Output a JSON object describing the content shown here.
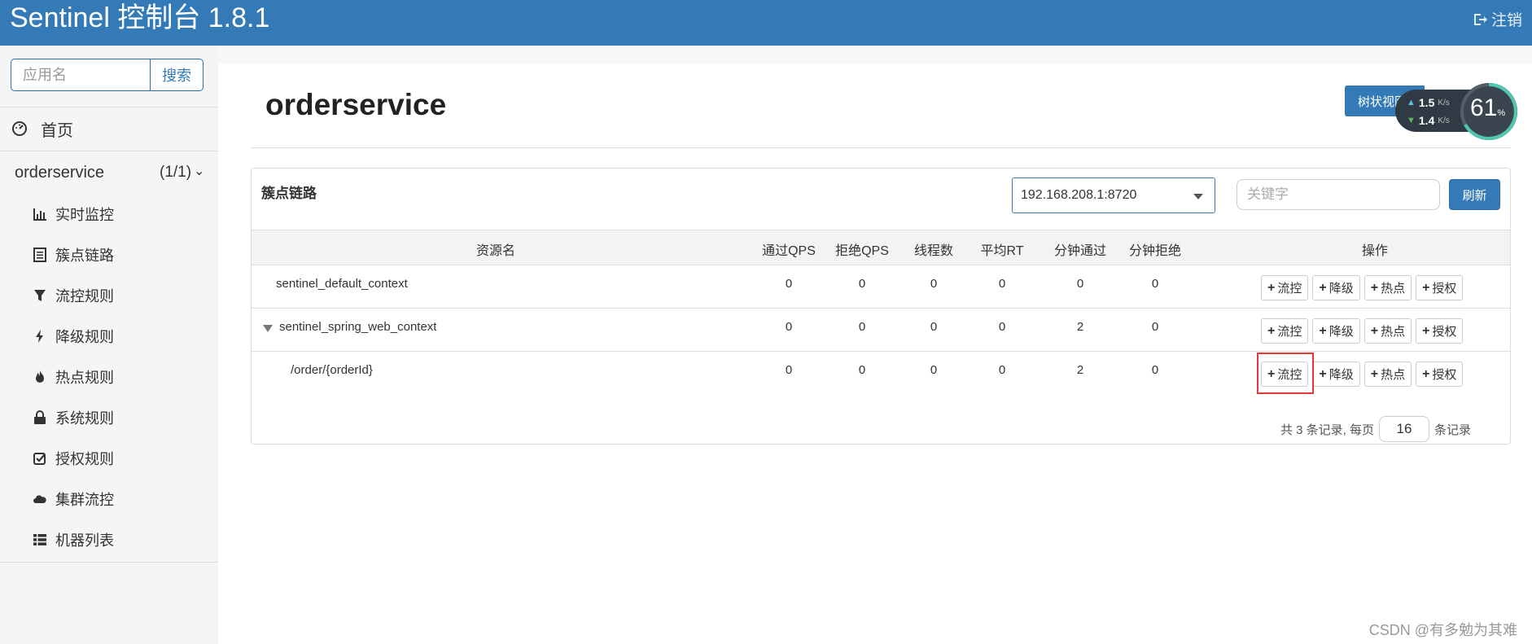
{
  "header": {
    "brand": "Sentinel 控制台 1.8.1",
    "logout_label": "注销"
  },
  "sidebar": {
    "search_placeholder": "应用名",
    "search_button": "搜索",
    "home_label": "首页",
    "app_name": "orderservice",
    "app_count": "(1/1)",
    "menu": [
      {
        "label": "实时监控",
        "icon": "bar-chart-icon"
      },
      {
        "label": "簇点链路",
        "icon": "list-icon"
      },
      {
        "label": "流控规则",
        "icon": "filter-icon"
      },
      {
        "label": "降级规则",
        "icon": "flash-icon"
      },
      {
        "label": "热点规则",
        "icon": "fire-icon"
      },
      {
        "label": "系统规则",
        "icon": "lock-icon"
      },
      {
        "label": "授权规则",
        "icon": "check-icon"
      },
      {
        "label": "集群流控",
        "icon": "cloud-icon"
      },
      {
        "label": "机器列表",
        "icon": "th-list-icon"
      }
    ]
  },
  "main": {
    "title": "orderservice",
    "tree_view_button": "树状视图",
    "panel_title": "簇点链路",
    "machine_select": "192.168.208.1:8720",
    "keyword_placeholder": "关键字",
    "refresh_button": "刷新",
    "columns": [
      "资源名",
      "通过QPS",
      "拒绝QPS",
      "线程数",
      "平均RT",
      "分钟通过",
      "分钟拒绝",
      "操作"
    ],
    "rows": [
      {
        "name": "sentinel_default_context",
        "pass_qps": "0",
        "block_qps": "0",
        "threads": "0",
        "avg_rt": "0",
        "min_pass": "0",
        "min_block": "0"
      },
      {
        "name": "sentinel_spring_web_context",
        "pass_qps": "0",
        "block_qps": "0",
        "threads": "0",
        "avg_rt": "0",
        "min_pass": "2",
        "min_block": "0"
      },
      {
        "name": "/order/{orderId}",
        "pass_qps": "0",
        "block_qps": "0",
        "threads": "0",
        "avg_rt": "0",
        "min_pass": "2",
        "min_block": "0"
      }
    ],
    "actions": {
      "flow": "流控",
      "degrade": "降级",
      "hotspot": "热点",
      "auth": "授权"
    },
    "pager": {
      "prefix": "共 3 条记录, 每页",
      "page_size": "16",
      "suffix": "条记录"
    }
  },
  "net_widget": {
    "up": "1.5",
    "down": "1.4",
    "unit": "K/s",
    "percent": "61",
    "percent_sign": "%"
  },
  "watermark": "CSDN @有多勉为其难",
  "colors": {
    "primary": "#337ab7",
    "highlight": "#e53935"
  }
}
